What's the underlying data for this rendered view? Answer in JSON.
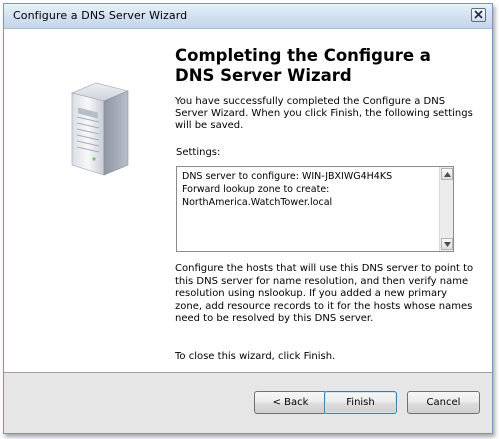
{
  "window": {
    "title": "Configure a DNS Server Wizard"
  },
  "main": {
    "heading": "Completing the Configure a DNS Server Wizard",
    "intro": "You have successfully completed the Configure a DNS Server Wizard. When you click Finish, the following settings will be saved.",
    "settings_label": "Settings:",
    "settings_text": "DNS server to configure: WIN-JBXIWG4H4KS\nForward lookup zone to create:\nNorthAmerica.WatchTower.local",
    "paragraph": "Configure the hosts that will use this DNS server to point to this DNS server for name resolution, and then verify name resolution using nslookup. If you added a new primary zone, add resource records to it for the hosts whose names need to be resolved by this DNS server.",
    "close_note": "To close this wizard, click Finish."
  },
  "footer": {
    "back_label": "< Back",
    "finish_label": "Finish",
    "cancel_label": "Cancel"
  },
  "icons": {
    "close": "close-icon",
    "server": "server-icon",
    "scroll_up": "scroll-up-arrow-icon",
    "scroll_down": "scroll-down-arrow-icon"
  }
}
